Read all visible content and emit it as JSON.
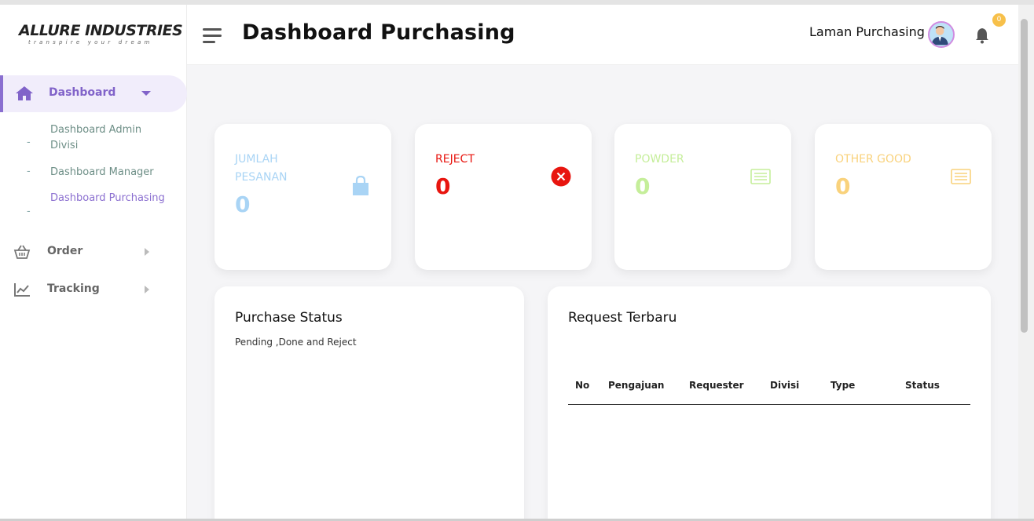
{
  "brand": {
    "name": "ALLURE INDUSTRIES",
    "tagline": "transpire your dream"
  },
  "sidebar": {
    "dashboard_label": "Dashboard",
    "sub_items": [
      {
        "label": "Dashboard Admin Divisi"
      },
      {
        "label": "Dashboard Manager"
      },
      {
        "label": "Dashboard Purchasing"
      }
    ],
    "order_label": "Order",
    "tracking_label": "Tracking"
  },
  "header": {
    "title": "Dashboard Purchasing",
    "user_name": "Laman Purchasing",
    "notification_count": "0"
  },
  "cards": [
    {
      "title": "JUMLAH PESANAN",
      "value": "0",
      "color": "#a9d4f5",
      "icon": "shopping-bag-icon"
    },
    {
      "title": "REJECT",
      "value": "0",
      "color": "#e8150f",
      "icon": "close-circle-icon"
    },
    {
      "title": "POWDER",
      "value": "0",
      "color": "#c5ee9a",
      "icon": "list-icon"
    },
    {
      "title": "OTHER GOOD",
      "value": "0",
      "color": "#f9d27c",
      "icon": "list-icon"
    }
  ],
  "purchase_status": {
    "title": "Purchase Status",
    "subtitle": "Pending ,Done and Reject"
  },
  "request_terbaru": {
    "title": "Request Terbaru",
    "columns": [
      "No",
      "Pengajuan",
      "Requester",
      "Divisi",
      "Type",
      "Status"
    ]
  },
  "colors": {
    "accent": "#8163c9",
    "accent_bg": "#f1edfb"
  }
}
